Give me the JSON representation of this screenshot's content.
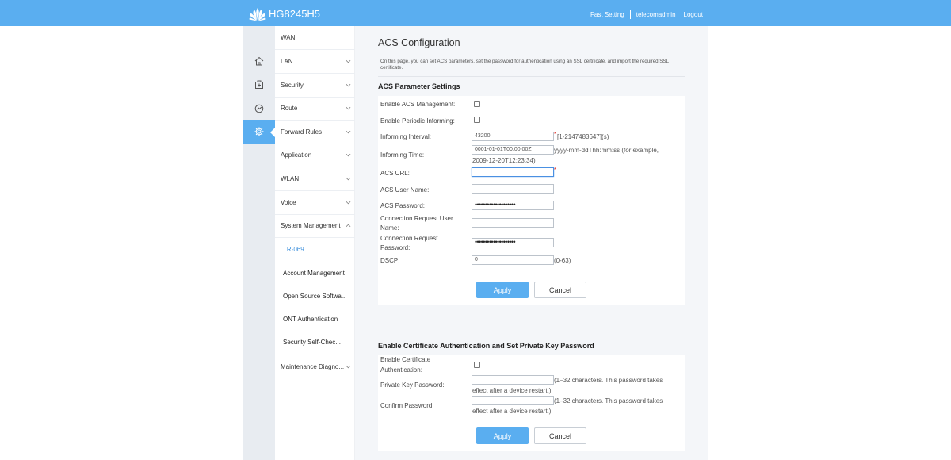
{
  "header": {
    "model": "HG8245H5",
    "links": [
      "Fast Setting",
      "telecomadmin",
      "Logout"
    ]
  },
  "rail": {
    "icons": [
      "home-icon",
      "plus-box-icon",
      "gauge-icon",
      "gear-icon"
    ],
    "active": "gear-icon"
  },
  "nav": {
    "items": [
      {
        "label": "WAN"
      },
      {
        "label": "LAN"
      },
      {
        "label": "Security"
      },
      {
        "label": "Route"
      },
      {
        "label": "Forward Rules"
      },
      {
        "label": "Application"
      },
      {
        "label": "WLAN"
      },
      {
        "label": "Voice"
      },
      {
        "label": "System Management"
      }
    ],
    "sub": [
      {
        "label": "TR-069",
        "current": true
      },
      {
        "label": "Account Management"
      },
      {
        "label": "Open Source Softwa..."
      },
      {
        "label": "ONT Authentication"
      },
      {
        "label": "Security Self-Chec..."
      }
    ],
    "last": {
      "label": "Maintenance Diagno..."
    }
  },
  "main": {
    "title": "ACS Configuration",
    "intro": "On this page, you can set ACS parameters, set the password for authentication using an SSL certificate, and import the required SSL certificate.",
    "acs": {
      "heading": "ACS Parameter Settings",
      "enable_acs_label": "Enable ACS Management:",
      "periodic_label": "Enable Periodic Informing:",
      "interval_label": "Informing Interval:",
      "interval_value": "43200",
      "interval_hint": "[1-2147483647](s)",
      "time_label": "Informing Time:",
      "time_value": "0001-01-01T00:00:00Z",
      "time_hint_1": "yyyy-mm-ddThh:mm:ss (for example,",
      "time_hint_2": "2009-12-20T12:23:34)",
      "url_label": "ACS URL:",
      "url_value": "",
      "user_label": "ACS User Name:",
      "user_value": "",
      "password_label": "ACS Password:",
      "password_value": "••••••••••••••••••••",
      "conn_user_label_1": "Connection Request User",
      "conn_user_label_2": "Name:",
      "conn_user_value": "",
      "conn_pwd_label_1": "Connection Request",
      "conn_pwd_label_2": "Password:",
      "conn_pwd_value": "••••••••••••••••••••",
      "dscp_label": "DSCP:",
      "dscp_value": "0",
      "dscp_hint": "(0-63)",
      "required_mark": "*",
      "apply": "Apply",
      "cancel": "Cancel"
    },
    "cert": {
      "heading": "Enable Certificate Authentication and Set Private Key Password",
      "enable_label_1": "Enable Certificate",
      "enable_label_2": "Authentication:",
      "key_label": "Private Key Password:",
      "key_hint_1": "(1–32 characters. This password takes",
      "key_hint_2": "effect after a device restart.)",
      "confirm_label": "Confirm Password:",
      "confirm_hint_1": "(1–32 characters. This password takes",
      "confirm_hint_2": "effect after a device restart.)",
      "apply": "Apply",
      "cancel": "Cancel"
    }
  },
  "colors": {
    "accent": "#5aaef0",
    "link_active": "#3c8fdc",
    "required": "#e0322b"
  }
}
